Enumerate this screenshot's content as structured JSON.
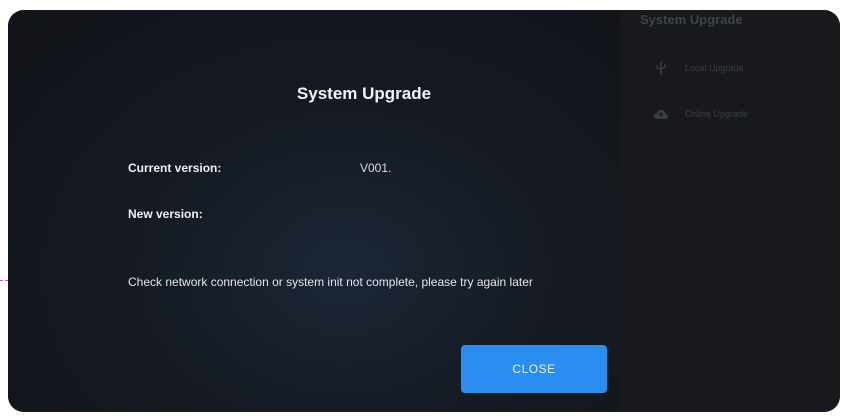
{
  "background": {
    "title": "System Upgrade",
    "menu": [
      {
        "label": "Local Upgrade",
        "icon": "usb-icon"
      },
      {
        "label": "Online Upgrade",
        "icon": "cloud-icon"
      }
    ]
  },
  "dialog": {
    "title": "System Upgrade",
    "current_version_label": "Current version:",
    "current_version_value": "V001.",
    "new_version_label": "New version:",
    "new_version_value": "",
    "message": "Check network connection or system init not complete, please try again later",
    "close_label": "CLOSE"
  },
  "colors": {
    "accent": "#2a8ef0",
    "annotation": "#e05a6a",
    "background": "#121418"
  }
}
